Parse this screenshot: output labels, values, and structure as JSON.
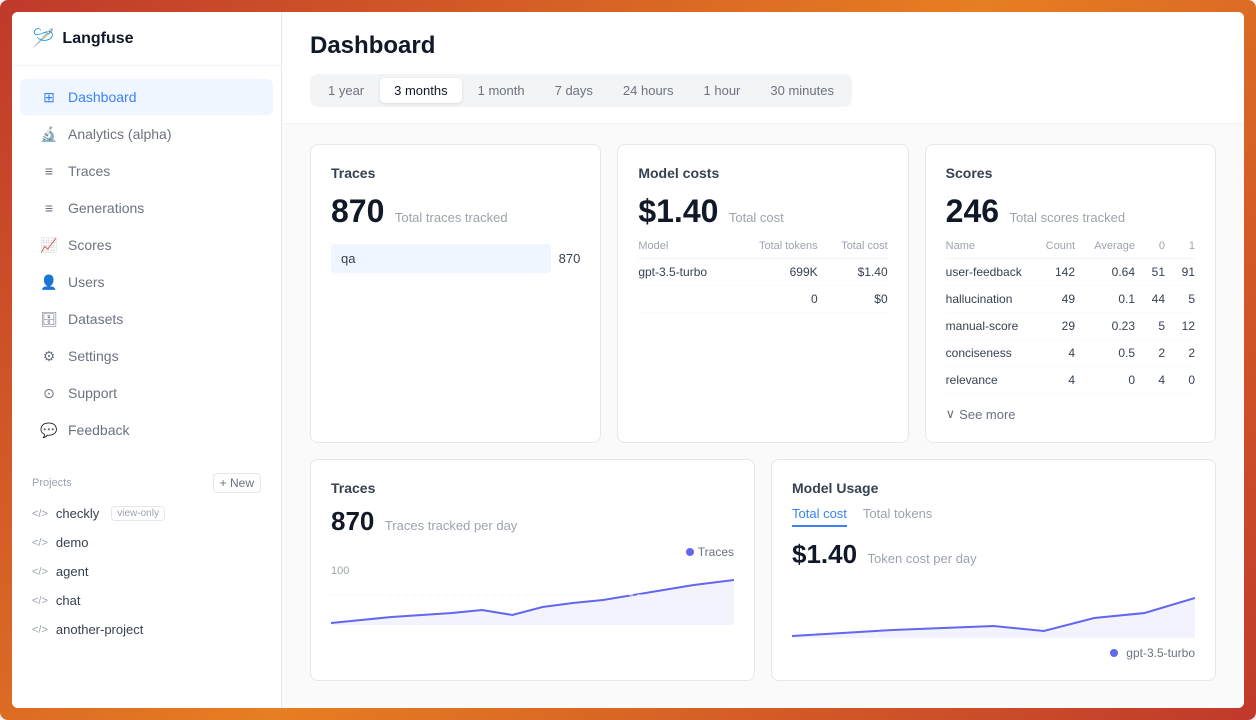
{
  "app": {
    "name": "Langfuse",
    "logo": "🪡"
  },
  "sidebar": {
    "nav_items": [
      {
        "id": "dashboard",
        "label": "Dashboard",
        "icon": "⊞",
        "active": true
      },
      {
        "id": "analytics",
        "label": "Analytics (alpha)",
        "icon": "🔬",
        "active": false
      },
      {
        "id": "traces",
        "label": "Traces",
        "icon": "≡",
        "active": false
      },
      {
        "id": "generations",
        "label": "Generations",
        "icon": "≡",
        "active": false
      },
      {
        "id": "scores",
        "label": "Scores",
        "icon": "📈",
        "active": false
      },
      {
        "id": "users",
        "label": "Users",
        "icon": "👤",
        "active": false
      },
      {
        "id": "datasets",
        "label": "Datasets",
        "icon": "🗄",
        "active": false
      },
      {
        "id": "settings",
        "label": "Settings",
        "icon": "⚙",
        "active": false
      },
      {
        "id": "support",
        "label": "Support",
        "icon": "⊙",
        "active": false
      },
      {
        "id": "feedback",
        "label": "Feedback",
        "icon": "💬",
        "active": false
      }
    ],
    "projects_label": "Projects",
    "new_btn": "+ New",
    "projects": [
      {
        "name": "checkly",
        "badge": "view-only"
      },
      {
        "name": "demo",
        "badge": ""
      },
      {
        "name": "agent",
        "badge": ""
      },
      {
        "name": "chat",
        "badge": ""
      },
      {
        "name": "another-project",
        "badge": ""
      }
    ]
  },
  "page": {
    "title": "Dashboard"
  },
  "time_filters": {
    "options": [
      "1 year",
      "3 months",
      "1 month",
      "7 days",
      "24 hours",
      "1 hour",
      "30 minutes"
    ],
    "active": "3 months"
  },
  "traces_card": {
    "title": "Traces",
    "count": "870",
    "label": "Total traces tracked",
    "bar_label": "qa",
    "bar_value": "870"
  },
  "model_costs_card": {
    "title": "Model costs",
    "total": "$1.40",
    "total_label": "Total cost",
    "columns": [
      "Model",
      "Total tokens",
      "Total cost"
    ],
    "rows": [
      {
        "model": "gpt-3.5-turbo",
        "tokens": "699K",
        "cost": "$1.40"
      },
      {
        "model": "",
        "tokens": "0",
        "cost": "$0"
      }
    ]
  },
  "scores_card": {
    "title": "Scores",
    "count": "246",
    "label": "Total scores tracked",
    "columns": [
      "Name",
      "Count",
      "Average",
      "0",
      "1"
    ],
    "rows": [
      {
        "name": "user-feedback",
        "count": "142",
        "avg": "0.64",
        "zero": "51",
        "one": "91"
      },
      {
        "name": "hallucination",
        "count": "49",
        "avg": "0.1",
        "zero": "44",
        "one": "5"
      },
      {
        "name": "manual-score",
        "count": "29",
        "avg": "0.23",
        "zero": "5",
        "one": "12"
      },
      {
        "name": "conciseness",
        "count": "4",
        "avg": "0.5",
        "zero": "2",
        "one": "2"
      },
      {
        "name": "relevance",
        "count": "4",
        "avg": "0",
        "zero": "4",
        "one": "0"
      }
    ],
    "see_more": "See more"
  },
  "traces_chart_card": {
    "title": "Traces",
    "count": "870",
    "label": "Traces tracked per day",
    "y_label": "100",
    "legend": "Traces",
    "legend_color": "#6366f1"
  },
  "model_usage_card": {
    "title": "Model Usage",
    "tabs": [
      "Total cost",
      "Total tokens"
    ],
    "active_tab": "Total cost",
    "amount": "$1.40",
    "amount_label": "Token cost per day",
    "legend": "gpt-3.5-turbo",
    "legend_color": "#6366f1"
  }
}
